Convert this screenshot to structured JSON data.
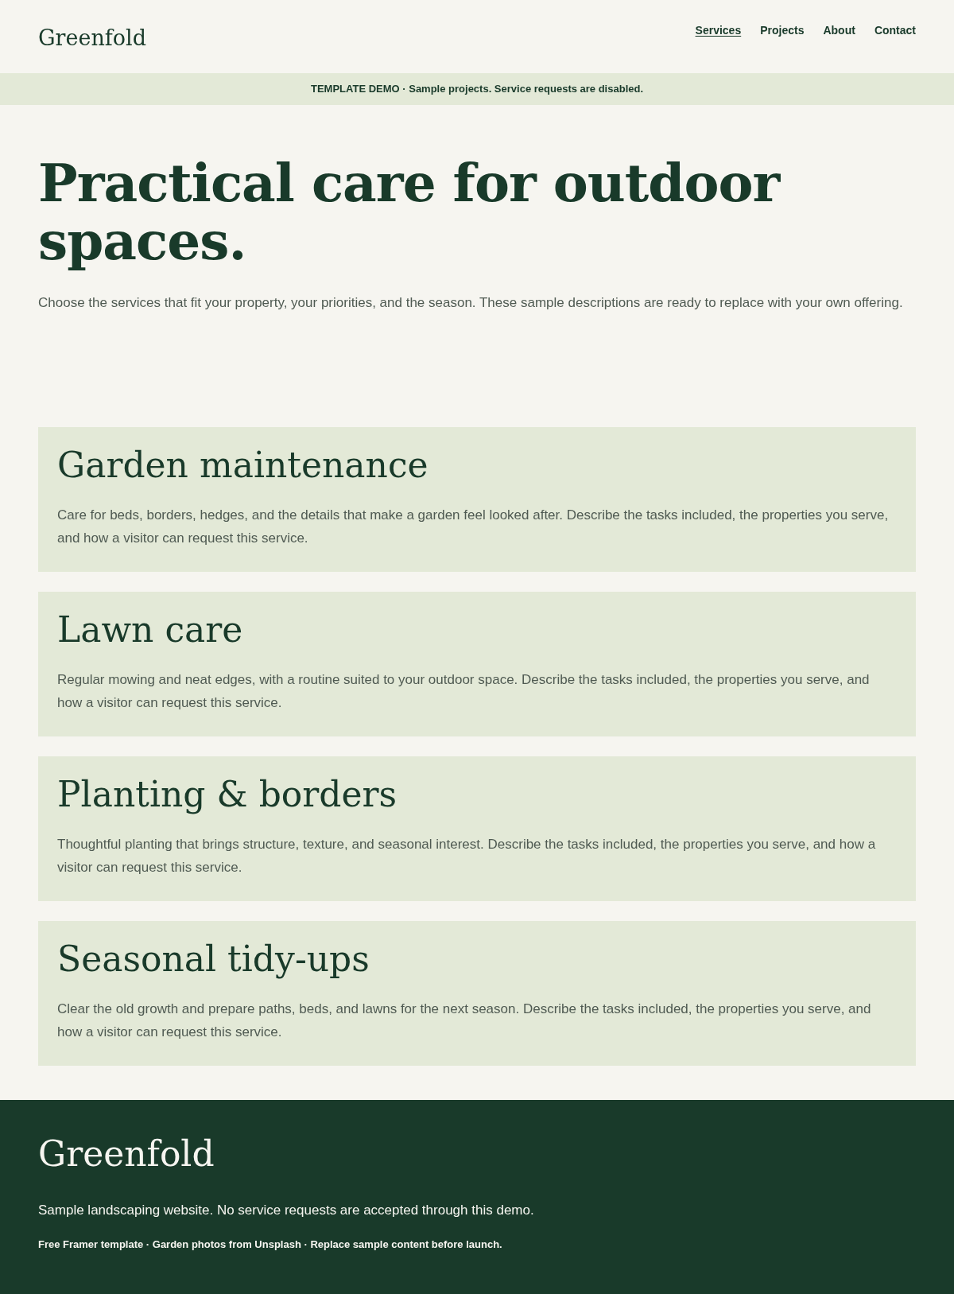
{
  "header": {
    "logo": "Greenfold",
    "nav": [
      {
        "label": "Services",
        "selected": true
      },
      {
        "label": "Projects",
        "selected": false
      },
      {
        "label": "About",
        "selected": false
      },
      {
        "label": "Contact",
        "selected": false
      }
    ]
  },
  "banner": "TEMPLATE DEMO · Sample projects. Service requests are disabled.",
  "hero": {
    "title": "Practical care for outdoor spaces.",
    "intro": "Choose the services that fit your property, your priorities, and the season. These sample descriptions are ready to replace with your own offering."
  },
  "services": [
    {
      "title": "Garden maintenance",
      "description": "Care for beds, borders, hedges, and the details that make a garden feel looked after. Describe the tasks included, the properties you serve, and how a visitor can request this service."
    },
    {
      "title": "Lawn care",
      "description": "Regular mowing and neat edges, with a routine suited to your outdoor space. Describe the tasks included, the properties you serve, and how a visitor can request this service."
    },
    {
      "title": "Planting & borders",
      "description": "Thoughtful planting that brings structure, texture, and seasonal interest. Describe the tasks included, the properties you serve, and how a visitor can request this service."
    },
    {
      "title": "Seasonal tidy-ups",
      "description": "Clear the old growth and prepare paths, beds, and lawns for the next season. Describe the tasks included, the properties you serve, and how a visitor can request this service."
    }
  ],
  "footer": {
    "logo": "Greenfold",
    "tagline": "Sample landscaping website. No service requests are accepted through this demo.",
    "credits": "Free Framer template · Garden photos from Unsplash · Replace sample content before launch."
  }
}
